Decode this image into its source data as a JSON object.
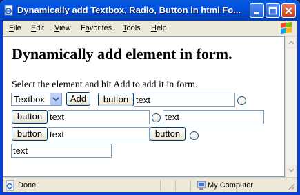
{
  "window": {
    "title": "Dynamically add Textbox, Radio, Button in html Fo..."
  },
  "menu": {
    "items": [
      {
        "label": "File",
        "accel": "F",
        "rest": "ile"
      },
      {
        "label": "Edit",
        "accel": "E",
        "rest": "dit"
      },
      {
        "label": "View",
        "accel": "V",
        "rest": "iew"
      },
      {
        "label": "Favorites",
        "accel": "",
        "pre": "F",
        "mid": "a",
        "post": "vorites"
      },
      {
        "label": "Tools",
        "accel": "T",
        "rest": "ools"
      },
      {
        "label": "Help",
        "accel": "H",
        "rest": "elp"
      }
    ]
  },
  "page": {
    "heading": "Dynamically add element in form.",
    "instructions": "Select the element and hit Add to add it in form.",
    "select_value": "Textbox",
    "add_label": "Add",
    "button_label": "button",
    "textbox_value": "text"
  },
  "status": {
    "text": "Done",
    "zone": "My Computer"
  },
  "colors": {
    "titlebar": "#0054e3",
    "close_button": "#c5401e",
    "content_border": "#7f9db9"
  },
  "icons": [
    "ie-page-icon",
    "minimize-icon",
    "maximize-icon",
    "close-icon",
    "windows-logo-icon",
    "done-page-icon",
    "my-computer-icon",
    "resize-grip-icon",
    "chevron-down-icon"
  ]
}
